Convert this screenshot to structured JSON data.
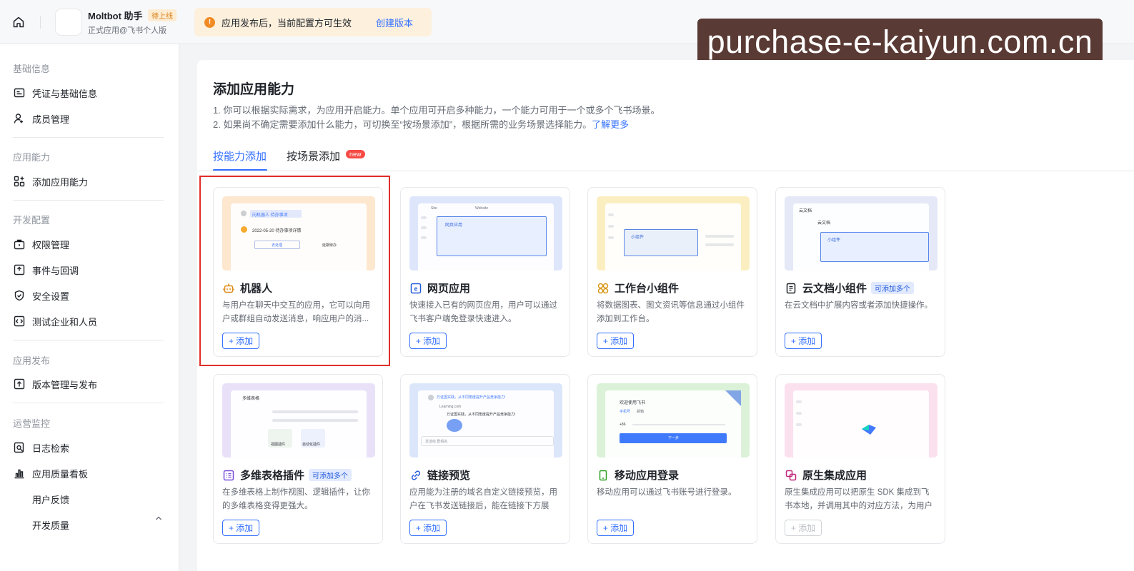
{
  "topbar": {
    "app_name": "Moltbot 助手",
    "app_status": "待上线",
    "app_subtitle": "正式应用@飞书个人版",
    "notice_icon": "!",
    "notice_text": "应用发布后，当前配置方可生效",
    "notice_link": "创建版本"
  },
  "watermark": "purchase-e-kaiyun.com.cn",
  "sidebar": {
    "sections": [
      {
        "title": "基础信息",
        "items": [
          {
            "label": "凭证与基础信息"
          },
          {
            "label": "成员管理"
          }
        ]
      },
      {
        "title": "应用能力",
        "items": [
          {
            "label": "添加应用能力"
          }
        ]
      },
      {
        "title": "开发配置",
        "items": [
          {
            "label": "权限管理"
          },
          {
            "label": "事件与回调"
          },
          {
            "label": "安全设置"
          },
          {
            "label": "测试企业和人员"
          }
        ]
      },
      {
        "title": "应用发布",
        "items": [
          {
            "label": "版本管理与发布"
          }
        ]
      },
      {
        "title": "运营监控",
        "items": [
          {
            "label": "日志检索"
          },
          {
            "label": "应用质量看板"
          },
          {
            "label": "用户反馈"
          },
          {
            "label": "开发质量"
          }
        ]
      }
    ]
  },
  "main": {
    "title": "添加应用能力",
    "desc1": "1. 你可以根据实际需求，为应用开启能力。单个应用可开启多种能力，一个能力可用于一个或多个飞书场景。",
    "desc2": "2. 如果尚不确定需要添加什么能力，可切换至“按场景添加”，根据所需的业务场景选择能力。",
    "desc2_link": "了解更多",
    "tabs": [
      {
        "label": "按能力添加",
        "active": true
      },
      {
        "label": "按场景添加"
      }
    ],
    "new_badge": "new",
    "add_label": "+ 添加",
    "multi_badge": "可添加多个",
    "cards": [
      {
        "title": "机器人",
        "desc": "与用户在聊天中交互的应用，它可以向用户或群组自动发送消息，响应用户的消...",
        "thumb_color": "#fde7cf",
        "icon": "robot-icon",
        "disabled": false,
        "thumb_text": [
          "向机器人 待办事项",
          "2022-05-20 待办事项详情",
          "去处理",
          "延期待办"
        ]
      },
      {
        "title": "网页应用",
        "desc": "快速接入已有的网页应用，用户可以通过飞书客户端免登录快速进入。",
        "thumb_color": "#dde6fb",
        "icon": "web-app-icon",
        "disabled": false,
        "thumb_text": [
          "Site",
          "Website",
          "网页应用"
        ]
      },
      {
        "title": "工作台小组件",
        "desc": "将数据图表、图文资讯等信息通过小组件添加到工作台。",
        "thumb_color": "#fbefc2",
        "icon": "widget-icon",
        "disabled": false,
        "thumb_text": [
          "小组件"
        ]
      },
      {
        "title": "云文档小组件",
        "desc": "在云文档中扩展内容或者添加快捷操作。",
        "thumb_color": "#e4e8f7",
        "icon": "doc-widget-icon",
        "multi": true,
        "disabled": false,
        "thumb_text": [
          "云文档",
          "云文档",
          "小组件"
        ]
      },
      {
        "title": "多维表格插件",
        "desc": "在多维表格上制作视图、逻辑插件，让你的多维表格变得更强大。",
        "thumb_color": "#e8e1f8",
        "icon": "bitable-plugin-icon",
        "multi": true,
        "disabled": false,
        "thumb_text": [
          "多维表格",
          "视图插件",
          "自动化插件"
        ]
      },
      {
        "title": "链接预览",
        "desc": "应用能为注册的域名自定义链接预览，用户在飞书发送链接后，能在链接下方展示...",
        "thumb_color": "#dce6fa",
        "icon": "link-preview-icon",
        "disabled": false,
        "thumb_text": [
          "万证国实践，从不同角度提升产品竞争能力!",
          "Learning.com",
          "万证国实践，从不同角度提升产品竞争能力!",
          "发送给 群组名"
        ]
      },
      {
        "title": "移动应用登录",
        "desc": "移动应用可以通过飞书账号进行登录。",
        "thumb_color": "#dbf2d8",
        "icon": "mobile-login-icon",
        "disabled": false,
        "thumb_text": [
          "欢迎使用飞书",
          "手机号",
          "邮箱",
          "+86",
          "下一步"
        ]
      },
      {
        "title": "原生集成应用",
        "desc": "原生集成应用可以把原生 SDK 集成到飞书本地，并调用其中的对应方法，为用户提...",
        "thumb_color": "#fbe0ee",
        "icon": "native-integration-icon",
        "disabled": true,
        "thumb_text": []
      }
    ]
  },
  "colors": {
    "accent": "#3370ff",
    "highlight_border": "#e02e2a",
    "watermark_bg": "#5a3a34"
  }
}
